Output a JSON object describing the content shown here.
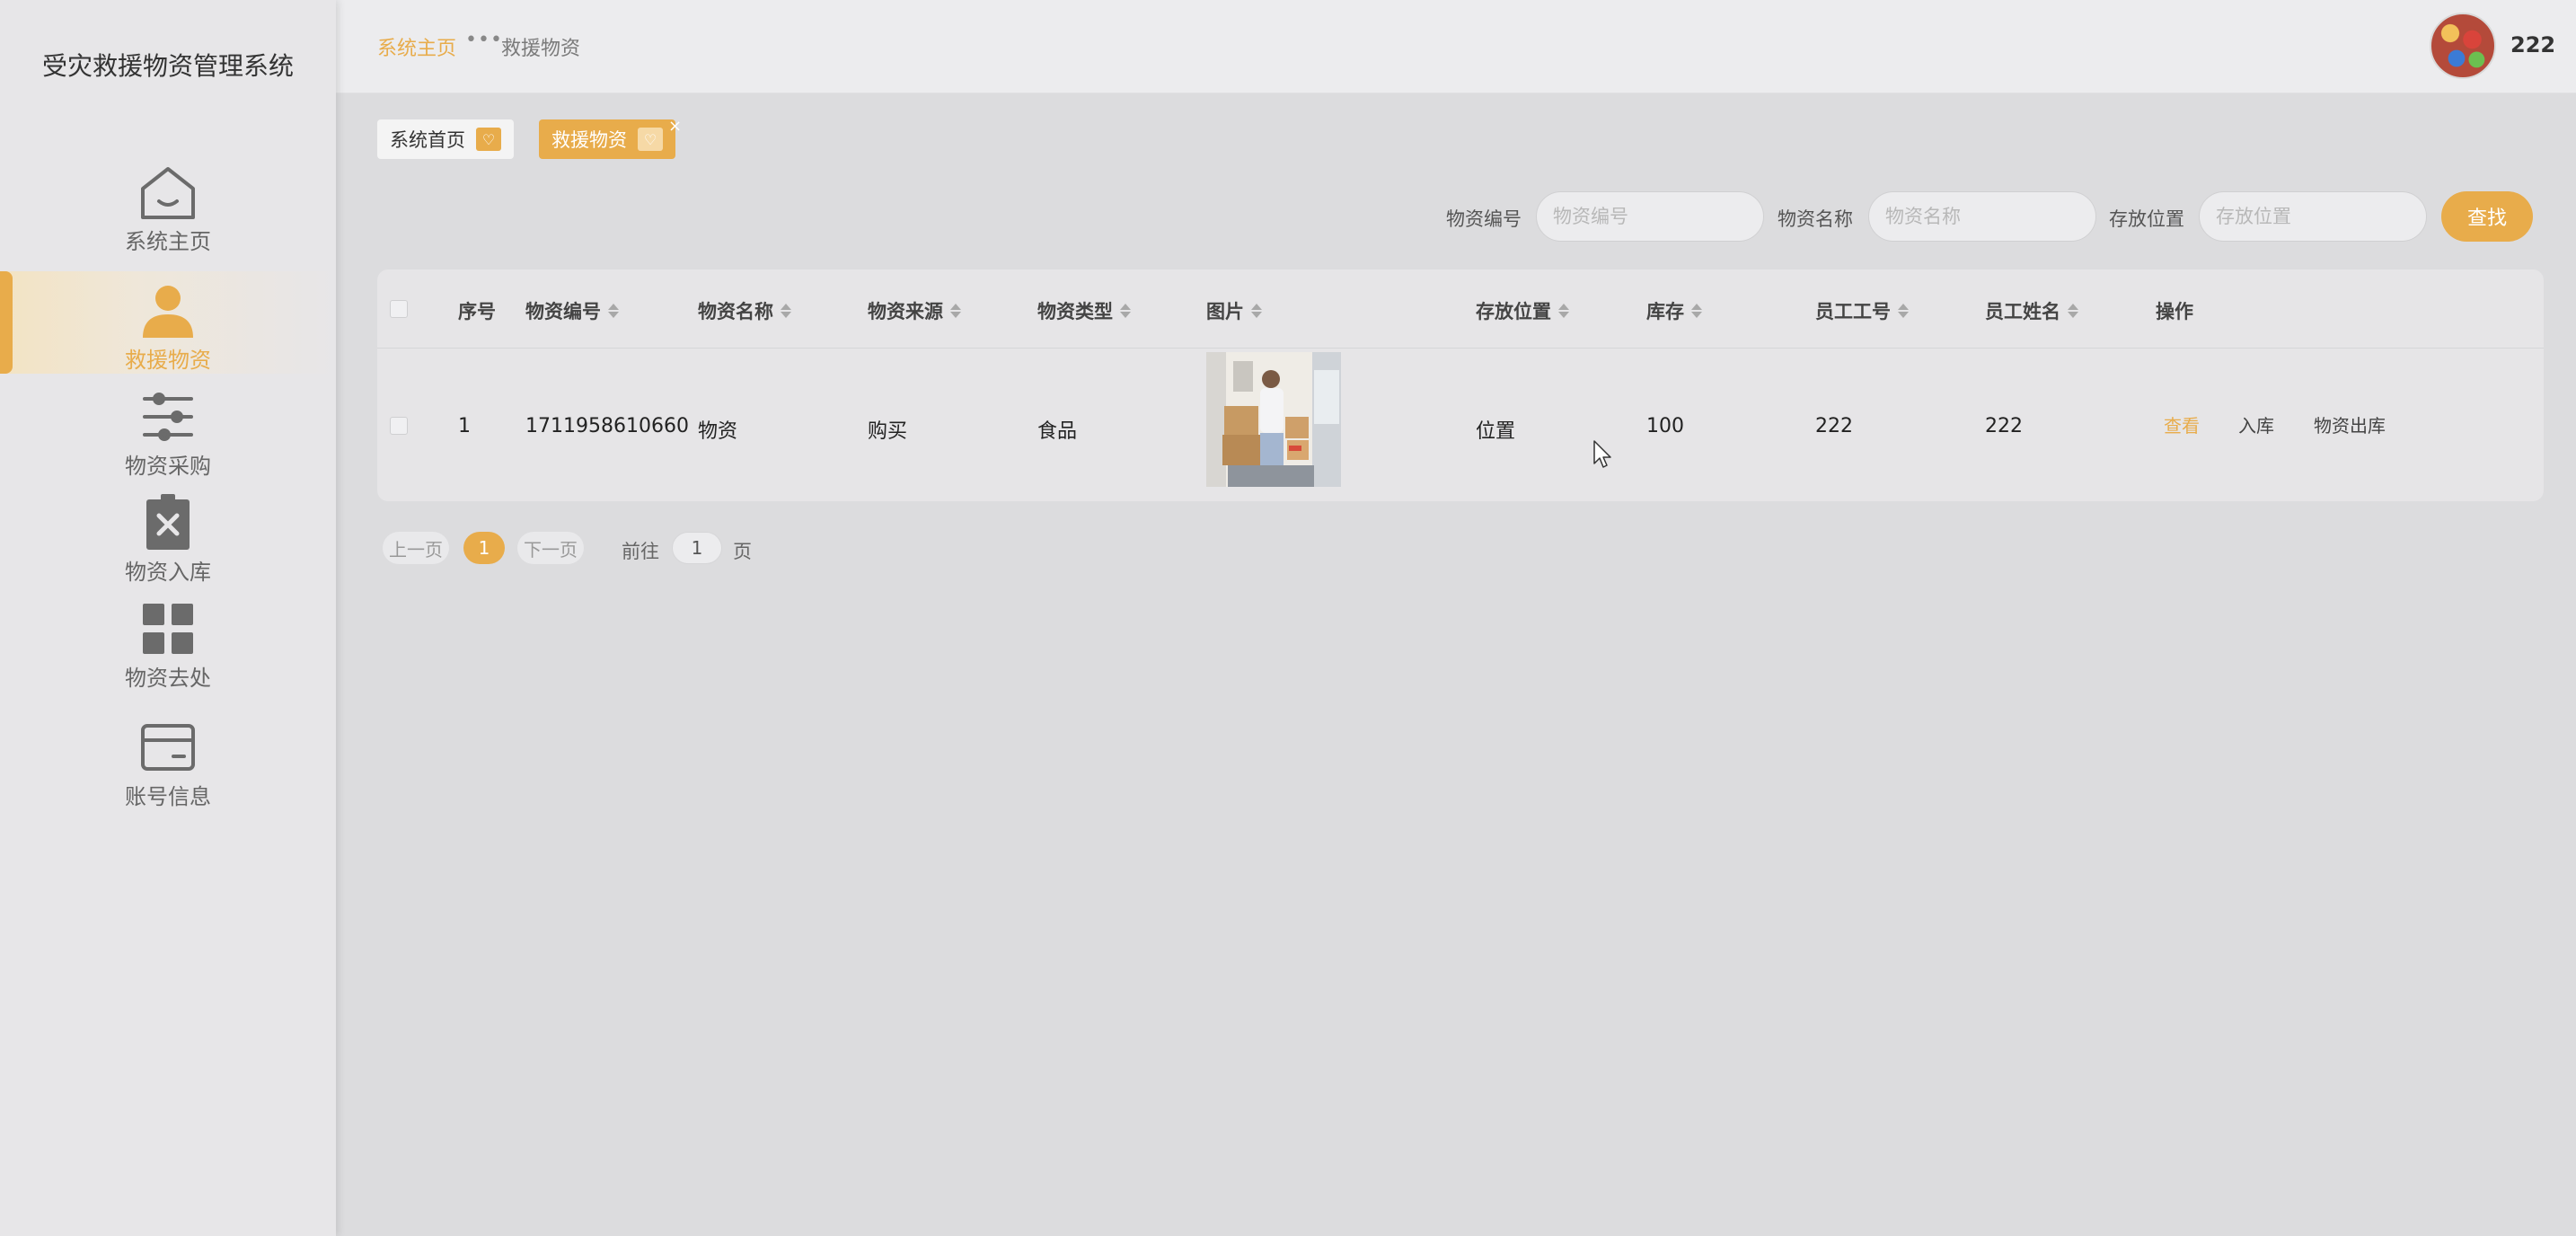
{
  "app": {
    "title": "受灾救援物资管理系统"
  },
  "colors": {
    "accent": "#e8ac4b",
    "sidebar_bg": "#e7e6e8",
    "page_bg": "#dcdcde"
  },
  "sidebar": {
    "items": [
      {
        "label": "系统主页",
        "icon": "home-icon",
        "active": false
      },
      {
        "label": "救援物资",
        "icon": "person-icon",
        "active": true
      },
      {
        "label": "物资采购",
        "icon": "sliders-icon",
        "active": false
      },
      {
        "label": "物资入库",
        "icon": "clipboard-x-icon",
        "active": false
      },
      {
        "label": "物资去处",
        "icon": "grid-icon",
        "active": false
      },
      {
        "label": "账号信息",
        "icon": "card-icon",
        "active": false
      }
    ]
  },
  "header": {
    "breadcrumb": {
      "home": "系统主页",
      "separator": "•••",
      "current": "救援物资"
    },
    "user": {
      "name": "222"
    }
  },
  "tags": [
    {
      "label": "系统首页",
      "icon": "heart-icon"
    },
    {
      "label": "救援物资",
      "icon": "heart-icon",
      "close": "×"
    }
  ],
  "search": {
    "fields": [
      {
        "label": "物资编号",
        "placeholder": "物资编号"
      },
      {
        "label": "物资名称",
        "placeholder": "物资名称"
      },
      {
        "label": "存放位置",
        "placeholder": "存放位置"
      }
    ],
    "button": "查找"
  },
  "table": {
    "columns": [
      "序号",
      "物资编号",
      "物资名称",
      "物资来源",
      "物资类型",
      "图片",
      "存放位置",
      "库存",
      "员工工号",
      "员工姓名",
      "操作"
    ],
    "rows": [
      {
        "index": "1",
        "code": "1711958610660",
        "name": "物资",
        "source": "购买",
        "type": "食品",
        "location": "位置",
        "stock": "100",
        "emp_no": "222",
        "emp_name": "222",
        "actions": {
          "view": "查看",
          "in": "入库",
          "out": "物资出库"
        }
      }
    ]
  },
  "pagination": {
    "prev": "上一页",
    "current": "1",
    "next": "下一页",
    "goto_label": "前往",
    "goto_value": "1",
    "goto_suffix": "页"
  }
}
